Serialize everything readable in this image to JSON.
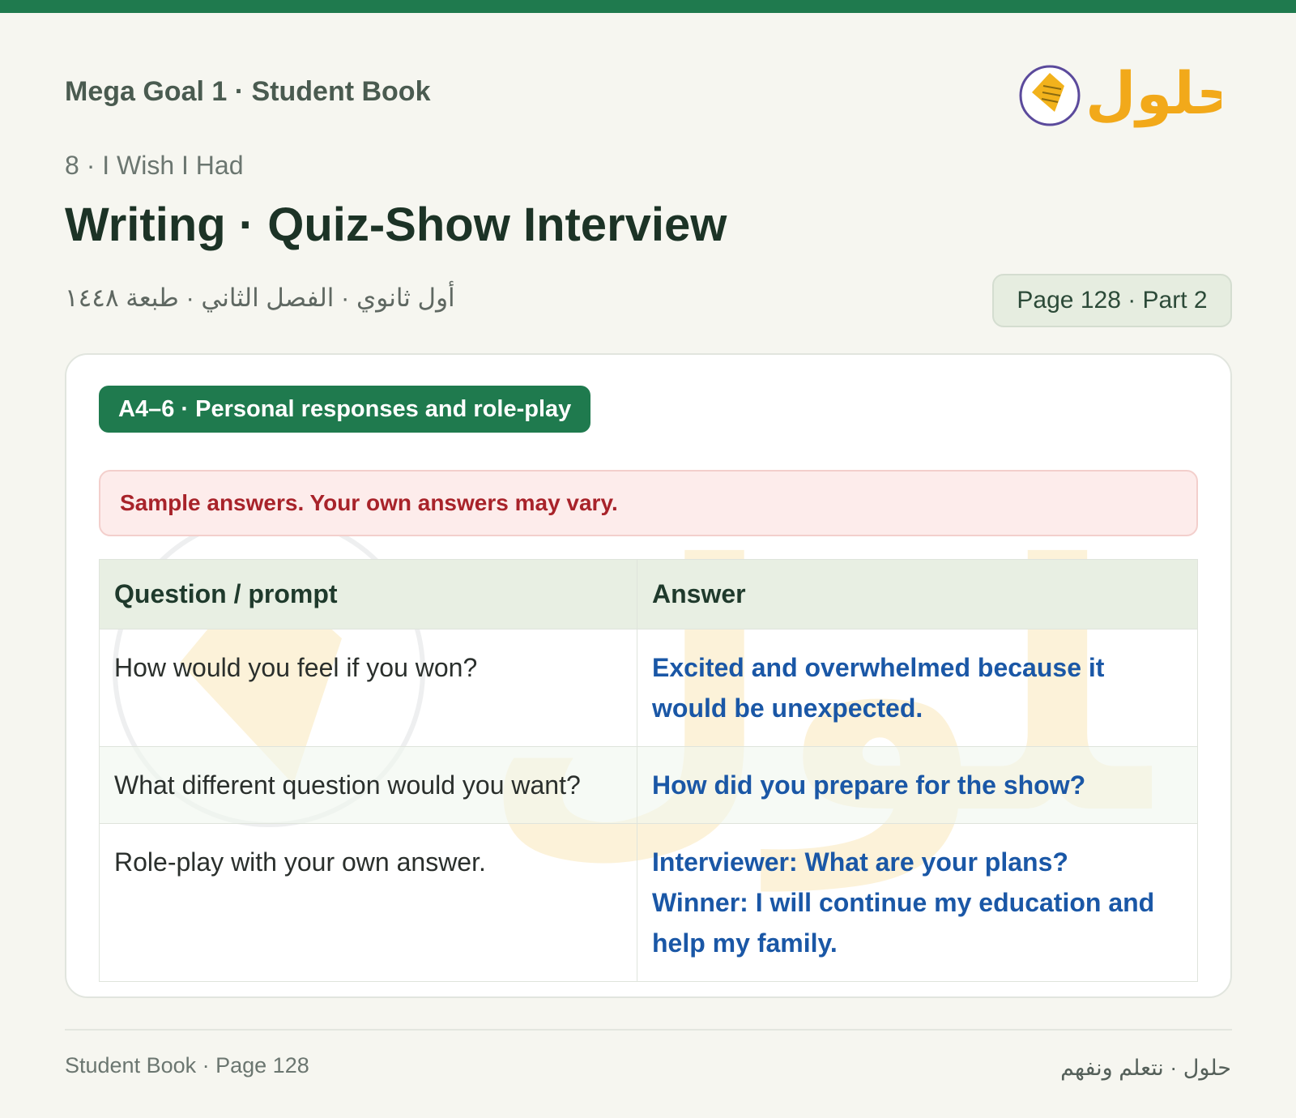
{
  "header": {
    "book_title": "Mega Goal 1 · Student Book",
    "unit": "8 · I Wish I Had",
    "page_title": "Writing · Quiz-Show Interview",
    "arabic_info": "أول ثانوي · الفصل الثاني · طبعة ١٤٤٨",
    "page_badge": "Page 128 · Part 2",
    "logo_text": "حلول"
  },
  "section": {
    "label": "A4–6 · Personal responses and role-play",
    "note": "Sample answers. Your own answers may vary."
  },
  "table": {
    "headers": [
      "Question / prompt",
      "Answer"
    ],
    "rows": [
      {
        "question": "How would you feel if you won?",
        "answer": [
          "Excited and overwhelmed because it would be unexpected."
        ]
      },
      {
        "question": "What different question would you want?",
        "answer": [
          "How did you prepare for the show?"
        ]
      },
      {
        "question": "Role-play with your own answer.",
        "answer": [
          "Interviewer: What are your plans?",
          "Winner: I will continue my education and help my family."
        ]
      }
    ]
  },
  "footer": {
    "left": "Student Book · Page 128",
    "right": "حلول · نتعلم ونفهم"
  },
  "colors": {
    "accent": "#1f7a4e",
    "answer": "#1a57a6",
    "note_text": "#a8232a",
    "note_bg": "#fdeceb",
    "header_bg": "#e8efe3",
    "logo_gold": "#f2b21c"
  }
}
